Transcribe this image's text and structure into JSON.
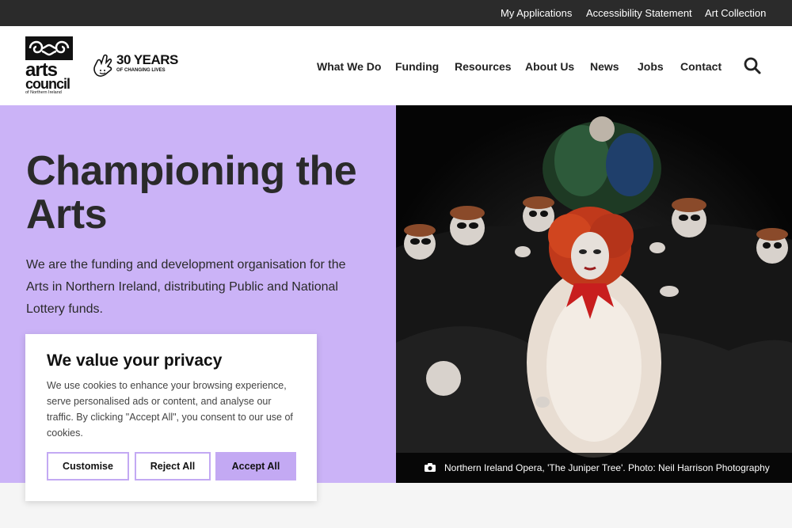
{
  "util_nav": [
    {
      "label": "My Applications"
    },
    {
      "label": "Accessibility Statement"
    },
    {
      "label": "Art Collection"
    }
  ],
  "logo": {
    "line1": "arts",
    "line2": "council",
    "line3": "of Northern Ireland"
  },
  "lottery_logo": {
    "big": "30 YEARS",
    "small": "OF CHANGING LIVES"
  },
  "main_nav": [
    {
      "label": "What We Do"
    },
    {
      "label": "Funding"
    },
    {
      "label": "Resources"
    },
    {
      "label": "About Us"
    },
    {
      "label": "News"
    },
    {
      "label": "Jobs"
    },
    {
      "label": "Contact"
    }
  ],
  "hero": {
    "title": "Championing the Arts",
    "description": "We are the funding and development organisation for the Arts in Northern Ireland, distributing Public and National Lottery funds.",
    "caption": "Northern Ireland Opera, 'The Juniper Tree'. Photo: Neil Harrison Photography"
  },
  "cookie": {
    "title": "We value your privacy",
    "body": "We use cookies to enhance your browsing experience, serve personalised ads or content, and analyse our traffic. By clicking \"Accept All\", you consent to our use of cookies.",
    "customise": "Customise",
    "reject": "Reject All",
    "accept": "Accept All"
  },
  "colors": {
    "accent": "#cbb3f7",
    "button_accent": "#c3a9f3",
    "util_bar": "#2b2b2b"
  },
  "icons": {
    "search": "search-icon",
    "camera": "camera-icon"
  }
}
